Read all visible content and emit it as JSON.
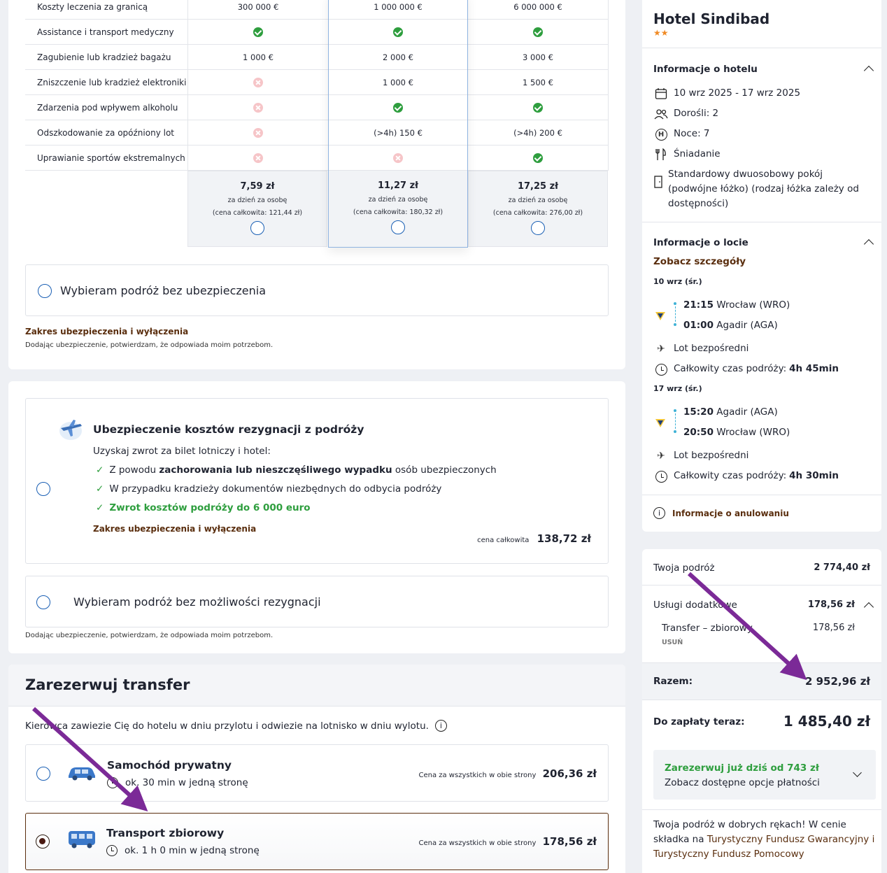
{
  "insurance_table": {
    "rows": [
      {
        "label": "Koszty leczenia za granicą",
        "c1": "300 000 €",
        "c2": "1 000 000 €",
        "c3": "6 000 000 €"
      },
      {
        "label": "Assistance i transport medyczny",
        "c1": "check",
        "c2": "check",
        "c3": "check"
      },
      {
        "label": "Zagubienie lub kradzież bagażu",
        "c1": "1 000 €",
        "c2": "2 000 €",
        "c3": "3 000 €"
      },
      {
        "label": "Zniszczenie lub kradzież elektroniki",
        "c1": "cross",
        "c2": "1 000 €",
        "c3": "1 500 €"
      },
      {
        "label": "Zdarzenia pod wpływem alkoholu",
        "c1": "cross",
        "c2": "check",
        "c3": "check"
      },
      {
        "label": "Odszkodowanie za opóźniony lot",
        "c1": "cross",
        "c2": "(>4h) 150 €",
        "c3": "(>4h) 200 €"
      },
      {
        "label": "Uprawianie sportów ekstremalnych",
        "c1": "cross",
        "c2": "cross",
        "c3": "check"
      }
    ],
    "prices": [
      {
        "price": "7,59 zł",
        "per": "za dzień za osobę",
        "total": "(cena całkowita: 121,44 zł)"
      },
      {
        "price": "11,27 zł",
        "per": "za dzień za osobę",
        "total": "(cena całkowita: 180,32 zł)"
      },
      {
        "price": "17,25 zł",
        "per": "za dzień za osobę",
        "total": "(cena całkowita: 276,00 zł)"
      }
    ],
    "no_insurance": "Wybieram podróż bez ubezpieczenia",
    "scope_link": "Zakres ubezpieczenia i wyłączenia",
    "disclaimer": "Dodając ubezpieczenie, potwierdzam, że odpowiada moim potrzebom."
  },
  "cancellation": {
    "title": "Ubezpieczenie kosztów rezygnacji z podróży",
    "intro": "Uzyskaj zwrot za bilet lotniczy i hotel:",
    "b1_pre": "Z powodu ",
    "b1_bold": "zachorowania lub nieszczęśliwego wypadku",
    "b1_post": " osób ubezpieczonych",
    "b2": "W przypadku kradzieży dokumentów niezbędnych do odbycia podróży",
    "b3": "Zwrot kosztów podróży do 6 000 euro",
    "scope_link": "Zakres ubezpieczenia i wyłączenia",
    "total_label": "cena całkowita",
    "total": "138,72 zł",
    "no_option": "Wybieram podróż bez możliwości rezygnacji",
    "disclaimer": "Dodając ubezpieczenie, potwierdzam, że odpowiada moim potrzebom."
  },
  "transfer": {
    "title": "Zarezerwuj transfer",
    "desc": "Kierowca zawiezie Cię do hotelu w dniu przylotu i odwiezie na lotnisko w dniu wylotu.",
    "options": [
      {
        "name": "Samochód prywatny",
        "time": "ok. 30 min w jedną stronę",
        "price_label": "Cena za wszystkich w obie strony",
        "price": "206,36 zł"
      },
      {
        "name": "Transport zbiorowy",
        "time": "ok. 1 h 0 min w jedną stronę",
        "price_label": "Cena za wszystkich w obie strony",
        "price": "178,56 zł"
      }
    ]
  },
  "hotel": {
    "country_code": "MA",
    "name": "Hotel Sindibad",
    "stars": "★★",
    "info_title": "Informacje o hotelu",
    "dates": "10 wrz 2025 - 17 wrz 2025",
    "adults": "Dorośli: 2",
    "nights": "Noce: 7",
    "board": "Śniadanie",
    "room": "Standardowy dwuosobowy pokój (podwójne łóżko) (rodzaj łóżka zależy od dostępności)"
  },
  "flights": {
    "title": "Informacje o locie",
    "details_link": "Zobacz szczegóły",
    "legs": [
      {
        "date": "10 wrz (śr.)",
        "dep_time": "21:15",
        "dep_place": "Wrocław (WRO)",
        "arr_time": "01:00",
        "arr_place": "Agadir (AGA)",
        "direct": "Lot bezpośredni",
        "duration_label": "Całkowity czas podróży: ",
        "duration": "4h 45min"
      },
      {
        "date": "17 wrz (śr.)",
        "dep_time": "15:20",
        "dep_place": "Agadir (AGA)",
        "arr_time": "20:50",
        "arr_place": "Wrocław (WRO)",
        "direct": "Lot bezpośredni",
        "duration_label": "Całkowity czas podróży: ",
        "duration": "4h 30min"
      }
    ],
    "cancel_info": "Informacje o anulowaniu"
  },
  "summary": {
    "trip_label": "Twoja podróż",
    "trip_value": "2 774,40 zł",
    "extras_label": "Usługi dodatkowe",
    "extras_value": "178,56 zł",
    "transfer_label": "Transfer – zbiorowy",
    "transfer_value": "178,56 zł",
    "remove": "USUŃ",
    "total_label": "Razem:",
    "total_value": "2 952,96 zł",
    "pay_now_label": "Do zapłaty teraz:",
    "pay_now_value": "1 485,40 zł",
    "promo_title": "Zarezerwuj już dziś od 743 zł",
    "promo_sub": "Zobacz dostępne opcje płatności",
    "trust_text": "Twoja podróż w dobrych rękach! W cenie składka na ",
    "trust_link": "Turystyczny Fundusz Gwarancyjny i Turystyczny Fundusz Pomocowy"
  },
  "colors": {
    "accent_blue": "#1a5fb4",
    "brown": "#5a2e0e",
    "green": "#2e9e3e",
    "arrow": "#7b2a97"
  }
}
